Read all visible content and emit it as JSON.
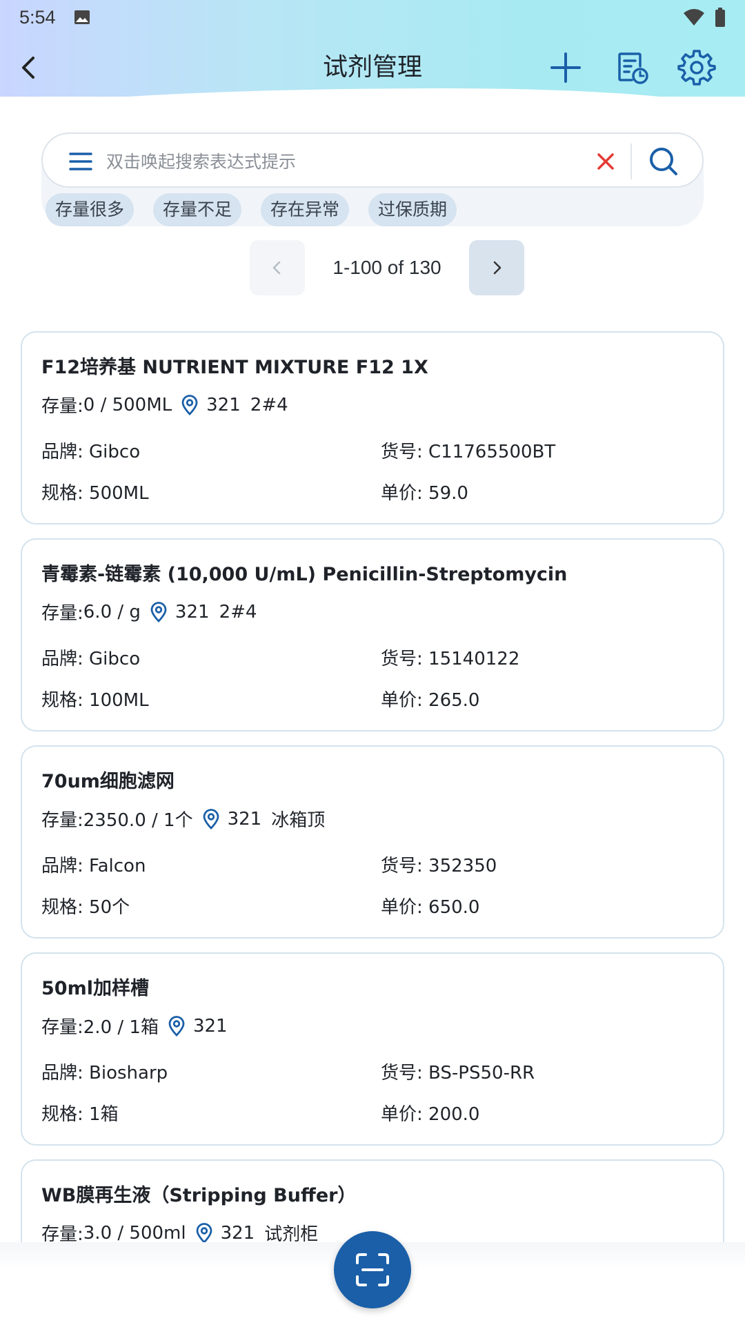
{
  "status": {
    "time": "5:54"
  },
  "header": {
    "title": "试剂管理"
  },
  "search": {
    "placeholder": "双击唤起搜索表达式提示",
    "chips": [
      "存量很多",
      "存量不足",
      "存在异常",
      "过保质期"
    ]
  },
  "pagination": {
    "range": "1-100 of 130"
  },
  "labels": {
    "stock": "存量: ",
    "brand": "品牌: ",
    "code": "货号: ",
    "spec": "规格: ",
    "price": "单价: "
  },
  "items": [
    {
      "name": "F12培养基 NUTRIENT MIXTURE F12 1X",
      "stock": "0 / 500ML",
      "location": "321",
      "position": "2#4",
      "brand": "Gibco",
      "code": "C11765500BT",
      "spec": "500ML",
      "price": "59.0"
    },
    {
      "name": "青霉素-链霉素 (10,000 U/mL) Penicillin-Streptomycin",
      "stock": "6.0 / g",
      "location": "321",
      "position": "2#4",
      "brand": "Gibco",
      "code": "15140122",
      "spec": "100ML",
      "price": "265.0"
    },
    {
      "name": "70um细胞滤网",
      "stock": "2350.0 / 1个",
      "location": "321",
      "position": "冰箱顶",
      "brand": "Falcon",
      "code": "352350",
      "spec": "50个",
      "price": "650.0"
    },
    {
      "name": "50ml加样槽",
      "stock": "2.0 / 1箱",
      "location": "321",
      "position": "",
      "brand": "Biosharp",
      "code": "BS-PS50-RR",
      "spec": "1箱",
      "price": "200.0"
    },
    {
      "name": "WB膜再生液（Stripping Buffer）",
      "stock": "3.0 / 500ml",
      "location": "321",
      "position": "试剂柜",
      "brand": "",
      "code": "",
      "spec": "",
      "price": ""
    }
  ],
  "colors": {
    "accent": "#1a5fa8",
    "chip_bg": "#d6e3f0",
    "clear": "#e53935"
  }
}
